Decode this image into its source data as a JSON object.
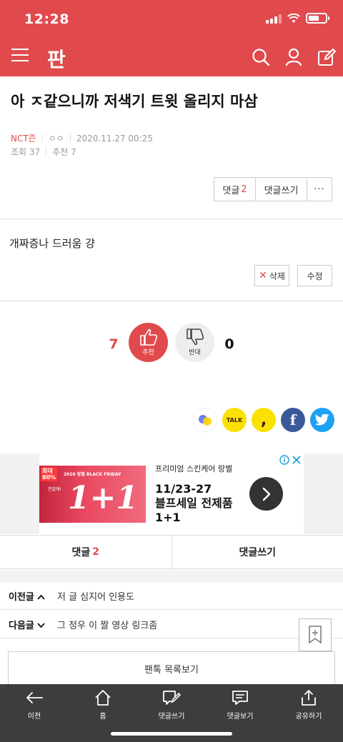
{
  "status_bar": {
    "time": "12:28"
  },
  "header": {
    "logo": "판",
    "icons": [
      "menu-icon",
      "search-icon",
      "user-icon",
      "edit-icon"
    ]
  },
  "article": {
    "title": "아 ㅈ같으니까 저색기 트윗 올리지 마삼",
    "author": "NCT즌",
    "nickname": "ㅇㅇ",
    "date": "2020.11.27 00:25",
    "views_label": "조회 37",
    "recommend_label": "추천 7",
    "body": "개짜증나 드러움 걍"
  },
  "top_buttons": {
    "comment_label": "댓글",
    "comment_count": "2",
    "write_label": "댓글쓰기",
    "more_label": "···"
  },
  "post_buttons": {
    "delete_label": "삭제",
    "edit_label": "수정"
  },
  "vote": {
    "up_count": "7",
    "up_label": "추천",
    "down_label": "반대",
    "down_count": "0"
  },
  "share": {
    "talk_label": "TALK",
    "story_label": ",",
    "facebook_label": "f"
  },
  "ad": {
    "badge_line1": "최대",
    "badge_line2": "80%",
    "banner_title": "2020 랑벨 BLACK FRIDAY",
    "banner_small": "연말에!",
    "banner_big": "1+1",
    "subtitle": "프리미엄 스킨케어 랑벨",
    "headline_1": "11/23-27",
    "headline_2": "블프세일 전제품",
    "headline_3": "1+1"
  },
  "comment_tabs": {
    "comments_label": "댓글",
    "comments_count": "2",
    "write_label": "댓글쓰기"
  },
  "prev_post": {
    "label": "이전글",
    "title": "저 글 심지어 인용도"
  },
  "next_post": {
    "label": "다음글",
    "title": "그 정우 이 짤 영상 링크좀"
  },
  "list_button": "팬톡 목록보기",
  "bottom_nav": [
    {
      "label": "이전",
      "icon": "back-arrow-icon"
    },
    {
      "label": "홈",
      "icon": "home-icon"
    },
    {
      "label": "댓글쓰기",
      "icon": "write-comment-icon"
    },
    {
      "label": "댓글보기",
      "icon": "view-comment-icon"
    },
    {
      "label": "공유하기",
      "icon": "share-icon"
    }
  ],
  "colors": {
    "brand": "#e04a4d",
    "bottom_bar": "#3d3d3d"
  }
}
